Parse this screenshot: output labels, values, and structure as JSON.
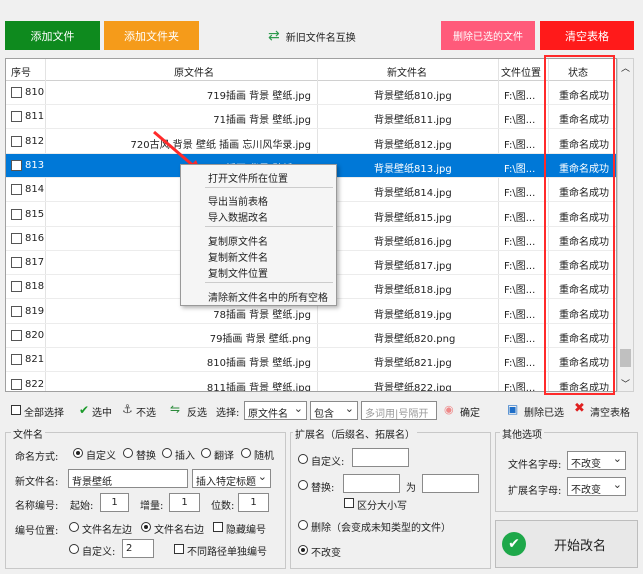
{
  "toolbar": {
    "add_file": "添加文件",
    "add_folder": "添加文件夹",
    "swap_names": "新旧文件名互换",
    "delete_selected": "删除已选的文件",
    "clear_table": "清空表格"
  },
  "table": {
    "headers": {
      "seq": "序号",
      "orig": "原文件名",
      "new": "新文件名",
      "loc": "文件位置",
      "status": "状态"
    },
    "rows": [
      {
        "seq": "810",
        "orig": "719插画  背景  壁纸.jpg",
        "new": "背景壁纸810.jpg",
        "loc": "F:\\图...",
        "status": "重命名成功"
      },
      {
        "seq": "811",
        "orig": "71插画  背景  壁纸.jpg",
        "new": "背景壁纸811.jpg",
        "loc": "F:\\图...",
        "status": "重命名成功"
      },
      {
        "seq": "812",
        "orig": "720古风  背景  壁纸  插画  忘川风华录.jpg",
        "new": "背景壁纸812.jpg",
        "loc": "F:\\图...",
        "status": "重命名成功"
      },
      {
        "seq": "813",
        "orig": "72插画  背景  壁纸.jpg",
        "new": "背景壁纸813.jpg",
        "loc": "F:\\图...",
        "status": "重命名成功"
      },
      {
        "seq": "814",
        "orig": "73插画",
        "new": "背景壁纸814.jpg",
        "loc": "F:\\图...",
        "status": "重命名成功"
      },
      {
        "seq": "815",
        "orig": "74插画",
        "new": "背景壁纸815.jpg",
        "loc": "F:\\图...",
        "status": "重命名成功"
      },
      {
        "seq": "816",
        "orig": "75插画",
        "new": "背景壁纸816.jpg",
        "loc": "F:\\图...",
        "status": "重命名成功"
      },
      {
        "seq": "817",
        "orig": "76插画",
        "new": "背景壁纸817.jpg",
        "loc": "F:\\图...",
        "status": "重命名成功"
      },
      {
        "seq": "818",
        "orig": "77插画",
        "new": "背景壁纸818.jpg",
        "loc": "F:\\图...",
        "status": "重命名成功"
      },
      {
        "seq": "819",
        "orig": "78插画  背景  壁纸.jpg",
        "new": "背景壁纸819.jpg",
        "loc": "F:\\图...",
        "status": "重命名成功"
      },
      {
        "seq": "820",
        "orig": "79插画  背景  壁纸.png",
        "new": "背景壁纸820.png",
        "loc": "F:\\图...",
        "status": "重命名成功"
      },
      {
        "seq": "821",
        "orig": "810插画  背景  壁纸.jpg",
        "new": "背景壁纸821.jpg",
        "loc": "F:\\图...",
        "status": "重命名成功"
      },
      {
        "seq": "822",
        "orig": "811插画  背景  壁纸.jpg",
        "new": "背景壁纸822.jpg",
        "loc": "F:\\图...",
        "status": "重命名成功"
      }
    ]
  },
  "context_menu": {
    "open_location": "打开文件所在位置",
    "export_table": "导出当前表格",
    "import_data": "导入数据改名",
    "copy_orig": "复制原文件名",
    "copy_new": "复制新文件名",
    "copy_loc": "复制文件位置",
    "clear_spaces": "清除新文件名中的所有空格"
  },
  "selection_bar": {
    "select_all": "全部选择",
    "select": "选中",
    "deselect": "不选",
    "invert": "反选",
    "choose_label": "选择:",
    "field_select": "原文件名",
    "mode_select": "包含",
    "search_placeholder": "多词用|号隔开",
    "confirm": "确定",
    "delete_selected": "删除已选",
    "clear_table": "清空表格"
  },
  "filename_panel": {
    "title": "文件名",
    "naming_label": "命名方式:",
    "opt_custom": "自定义",
    "opt_replace": "替换",
    "opt_insert": "插入",
    "opt_translate": "翻译",
    "opt_random": "随机",
    "new_name_label": "新文件名:",
    "new_name_value": "背景壁纸",
    "insert_special": "插入特定标题",
    "numbering_label": "名称编号:",
    "start_label": "起始:",
    "start_value": "1",
    "step_label": "增量:",
    "step_value": "1",
    "digits_label": "位数:",
    "digits_value": "1",
    "pos_label": "编号位置:",
    "pos_left": "文件名左边",
    "pos_right": "文件名右边",
    "hide_num": "隐藏编号",
    "pos_custom": "自定义:",
    "pos_custom_value": "2",
    "diff_path": "不同路径单独编号"
  },
  "ext_panel": {
    "title": "扩展名（后缀名、拓展名）",
    "custom": "自定义:",
    "replace": "替换:",
    "to": "为",
    "case_sensitive": "区分大小写",
    "delete": "删除（会变成未知类型的文件）",
    "unchanged": "不改变"
  },
  "other_panel": {
    "title": "其他选项",
    "filename_case_label": "文件名字母:",
    "filename_case_value": "不改变",
    "ext_case_label": "扩展名字母:",
    "ext_case_value": "不改变"
  },
  "start_button": "开始改名",
  "colors": {
    "add_file": "#0e8a1e",
    "add_folder": "#f59b1a",
    "delete_sel": "#ff5a7a",
    "clear": "#ff1a1a",
    "selected_row": "#0078d7",
    "highlight_box": "#ff2a2a"
  }
}
